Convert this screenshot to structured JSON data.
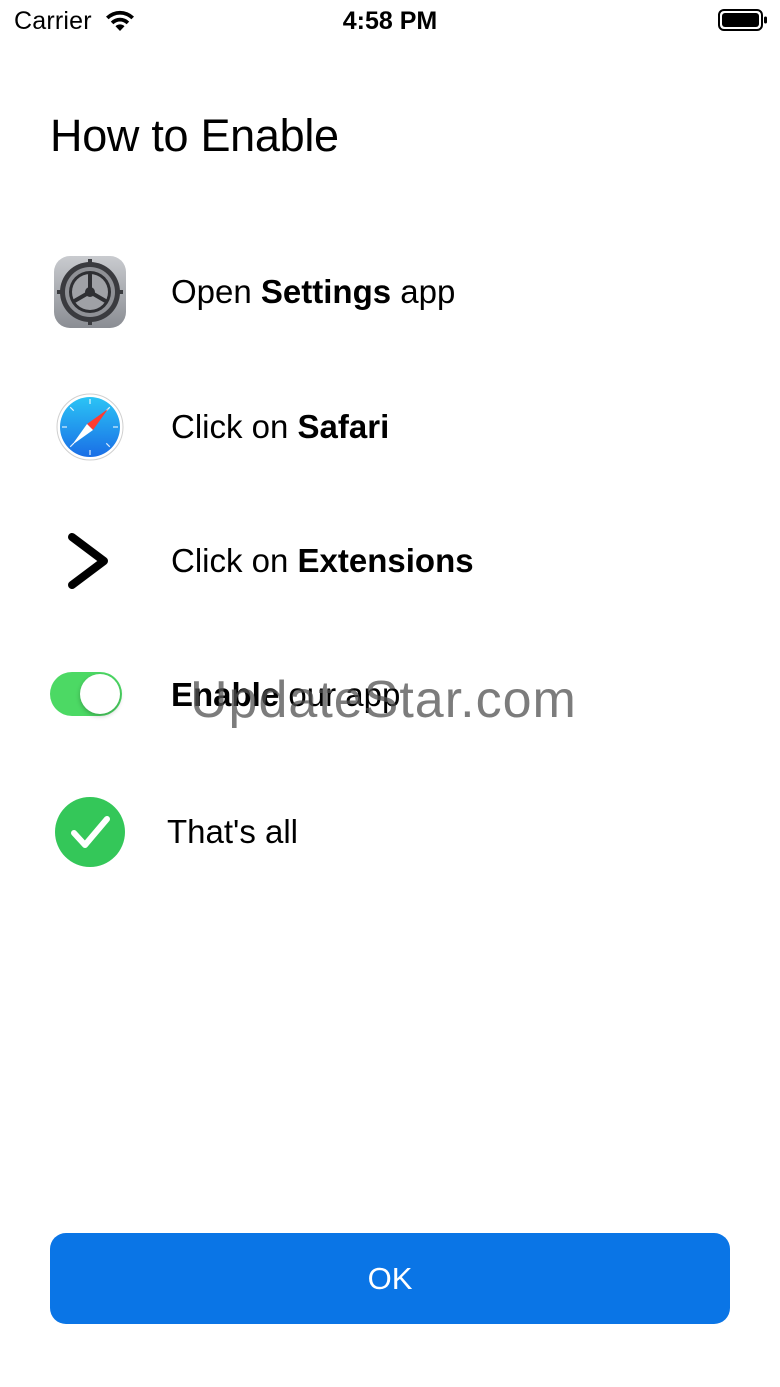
{
  "status_bar": {
    "carrier": "Carrier",
    "time": "4:58 PM"
  },
  "title": "How to Enable",
  "steps": [
    {
      "icon": "settings-icon",
      "prefix": "Open ",
      "bold": "Settings",
      "suffix": " app"
    },
    {
      "icon": "safari-icon",
      "prefix": "Click on ",
      "bold": "Safari",
      "suffix": ""
    },
    {
      "icon": "chevron-right-icon",
      "prefix": "Click on ",
      "bold": "Extensions",
      "suffix": ""
    },
    {
      "icon": "toggle-switch-icon",
      "prefix": "",
      "bold": "Enable",
      "suffix": " our app"
    },
    {
      "icon": "checkmark-circle-icon",
      "prefix": "That's all",
      "bold": "",
      "suffix": ""
    }
  ],
  "watermark": "UpdateStar.com",
  "ok_button": "OK",
  "colors": {
    "accent": "#0A75E6",
    "toggle_on": "#4CD964",
    "check_green": "#34C759"
  }
}
